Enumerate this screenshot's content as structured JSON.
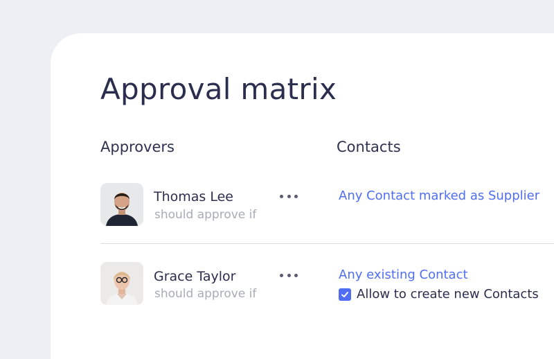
{
  "page": {
    "title": "Approval matrix"
  },
  "columns": {
    "approvers": "Approvers",
    "contacts": "Contacts"
  },
  "rows": [
    {
      "name": "Thomas Lee",
      "condition": "should approve if",
      "contact_rule": "Any Contact marked as Supplier",
      "avatar_icon": "person-avatar-icon",
      "menu_icon": "more-options-icon"
    },
    {
      "name": "Grace Taylor",
      "condition": "should approve if",
      "contact_rule": "Any existing Contact",
      "allow_create": {
        "checked": true,
        "label": "Allow to create new Contacts"
      },
      "avatar_icon": "person-avatar-icon",
      "menu_icon": "more-options-icon"
    }
  ],
  "colors": {
    "accent": "#4f6ef5",
    "text_primary": "#2b2d4f",
    "text_muted": "#a9abb6",
    "background": "#eeeff4",
    "card": "#ffffff"
  }
}
